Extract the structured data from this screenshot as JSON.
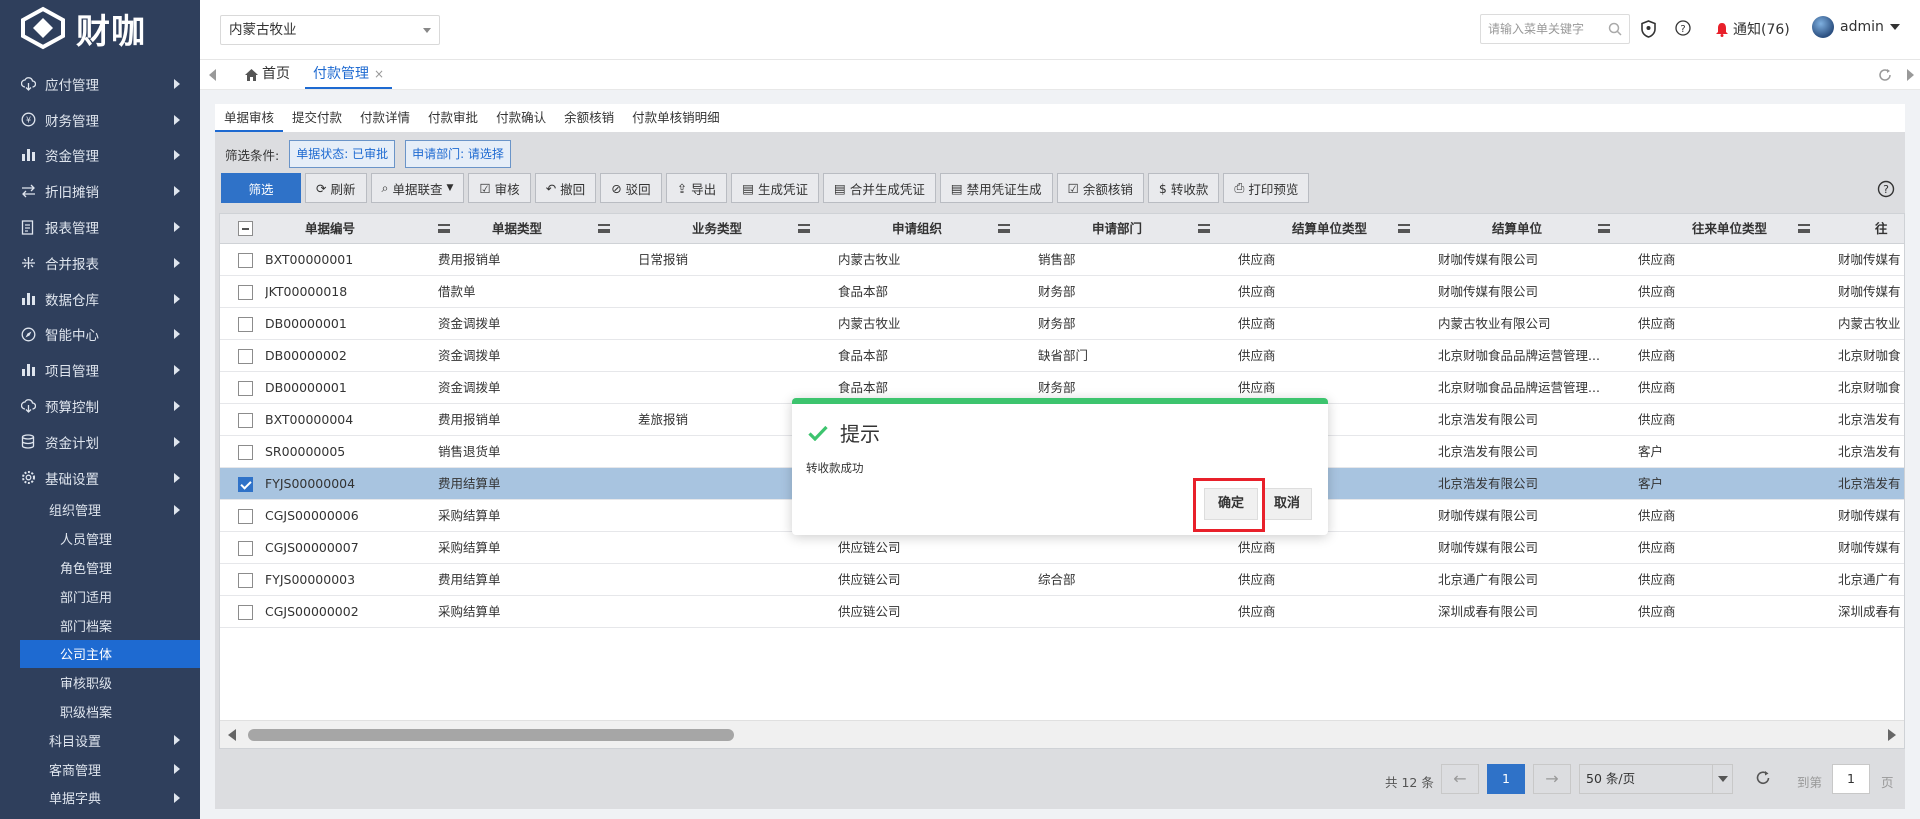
{
  "app": {
    "logo_text": "财咖",
    "accent": "#1e6ad1",
    "sidebar_bg": "#2f3f5c"
  },
  "sidebar": {
    "items": [
      {
        "label": "应付管理",
        "icon": "cloud-download-icon"
      },
      {
        "label": "财务管理",
        "icon": "yen-circle-icon"
      },
      {
        "label": "资金管理",
        "icon": "bar-chart-icon"
      },
      {
        "label": "折旧摊销",
        "icon": "swap-icon"
      },
      {
        "label": "报表管理",
        "icon": "report-icon"
      },
      {
        "label": "合并报表",
        "icon": "merge-icon"
      },
      {
        "label": "数据仓库",
        "icon": "bar-chart-icon"
      },
      {
        "label": "智能中心",
        "icon": "compass-icon"
      },
      {
        "label": "项目管理",
        "icon": "bar-chart-icon"
      },
      {
        "label": "预算控制",
        "icon": "cloud-download-icon"
      },
      {
        "label": "资金计划",
        "icon": "database-icon"
      },
      {
        "label": "基础设置",
        "icon": "gear-icon"
      }
    ],
    "sub_group": "组织管理",
    "leaves": [
      "人员管理",
      "角色管理",
      "部门适用",
      "部门档案",
      "公司主体",
      "审核职级",
      "职级档案"
    ],
    "active_leaf": "公司主体",
    "more_groups": [
      "科目设置",
      "客商管理",
      "单据字典"
    ]
  },
  "topbar": {
    "org": "内蒙古牧业",
    "search_placeholder": "请输入菜单关键字",
    "notice": "通知(76)",
    "user": "admin"
  },
  "tabs": {
    "home": "首页",
    "active": "付款管理",
    "close": "×"
  },
  "subtabs": [
    "单据审核",
    "提交付款",
    "付款详情",
    "付款审批",
    "付款确认",
    "余额核销",
    "付款单核销明细"
  ],
  "filters": {
    "label": "筛选条件:",
    "status": "单据状态: 已审批",
    "dept": "申请部门: 请选择"
  },
  "toolbar": {
    "filter": "筛选",
    "refresh": "刷新",
    "query": "单据联查",
    "audit": "审核",
    "revoke": "撤回",
    "reject": "驳回",
    "export": "导出",
    "voucher": "生成凭证",
    "merge_voucher": "合并生成凭证",
    "disable_voucher": "禁用凭证生成",
    "balance": "余额核销",
    "transfer": "转收款",
    "print": "打印预览"
  },
  "table": {
    "columns": [
      "单据编号",
      "单据类型",
      "业务类型",
      "申请组织",
      "申请部门",
      "结算单位类型",
      "结算单位",
      "往来单位类型",
      "往"
    ],
    "rows": [
      [
        "BXT00000001",
        "费用报销单",
        "日常报销",
        "内蒙古牧业",
        "销售部",
        "供应商",
        "财咖传媒有限公司",
        "供应商",
        "财咖传媒有"
      ],
      [
        "JKT00000018",
        "借款单",
        "",
        "食品本部",
        "财务部",
        "供应商",
        "财咖传媒有限公司",
        "供应商",
        "财咖传媒有"
      ],
      [
        "DB00000001",
        "资金调拨单",
        "",
        "内蒙古牧业",
        "财务部",
        "供应商",
        "内蒙古牧业有限公司",
        "供应商",
        "内蒙古牧业"
      ],
      [
        "DB00000002",
        "资金调拨单",
        "",
        "食品本部",
        "缺省部门",
        "供应商",
        "北京财咖食品品牌运营管理...",
        "供应商",
        "北京财咖食"
      ],
      [
        "DB00000001",
        "资金调拨单",
        "",
        "食品本部",
        "财务部",
        "供应商",
        "北京财咖食品品牌运营管理...",
        "供应商",
        "北京财咖食"
      ],
      [
        "BXT00000004",
        "费用报销单",
        "差旅报销",
        "",
        "",
        "",
        "北京浩发有限公司",
        "供应商",
        "北京浩发有"
      ],
      [
        "SR00000005",
        "销售退货单",
        "",
        "",
        "",
        "",
        "北京浩发有限公司",
        "客户",
        "北京浩发有"
      ],
      [
        "FYJS00000004",
        "费用结算单",
        "",
        "",
        "",
        "",
        "北京浩发有限公司",
        "客户",
        "北京浩发有"
      ],
      [
        "CGJS00000006",
        "采购结算单",
        "",
        "",
        "",
        "",
        "财咖传媒有限公司",
        "供应商",
        "财咖传媒有"
      ],
      [
        "CGJS00000007",
        "采购结算单",
        "",
        "供应链公司",
        "",
        "供应商",
        "财咖传媒有限公司",
        "供应商",
        "财咖传媒有"
      ],
      [
        "FYJS00000003",
        "费用结算单",
        "",
        "供应链公司",
        "综合部",
        "供应商",
        "北京通广有限公司",
        "供应商",
        "北京通广有"
      ],
      [
        "CGJS00000002",
        "采购结算单",
        "",
        "供应链公司",
        "",
        "供应商",
        "深圳成春有限公司",
        "供应商",
        "深圳成春有"
      ]
    ],
    "selected_row": 7
  },
  "pager": {
    "total": "共 12 条",
    "prev": "←",
    "next": "→",
    "page": "1",
    "size": "50 条/页",
    "goto": "到第",
    "goto_value": "1",
    "unit": "页"
  },
  "dialog": {
    "title": "提示",
    "message": "转收款成功",
    "ok": "确定",
    "cancel": "取消",
    "accent": "#3dc46e"
  }
}
